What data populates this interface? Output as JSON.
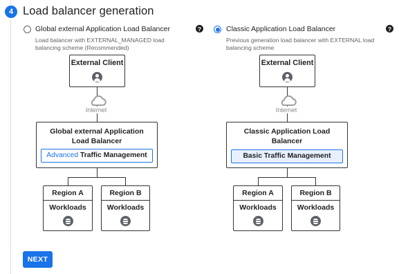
{
  "step": {
    "number": "4",
    "title": "Load balancer generation"
  },
  "options": [
    {
      "label": "Global external Application Load Balancer",
      "selected": false,
      "description_line1": "Load balancer with EXTERNAL_MANAGED load",
      "description_line2": "balancing scheme (Recommended)",
      "help": "?",
      "diagram": {
        "client": "External Client",
        "internet": "Internet",
        "lb_line1": "Global external Application",
        "lb_line2": "Load Balancer",
        "traffic_prefix": "Advanced",
        "traffic_suffix": "Traffic Management",
        "region_a": "Region A",
        "region_b": "Region B",
        "workloads": "Workloads"
      }
    },
    {
      "label": "Classic Application Load Balancer",
      "selected": true,
      "description_line1": "Previous generation load balancer with EXTERNAL load",
      "description_line2": "balancing scheme",
      "help": "?",
      "diagram": {
        "client": "External Client",
        "internet": "Internet",
        "lb_line1": "Classic Application Load",
        "lb_line2": "Balancer",
        "traffic": "Basic Traffic Management",
        "region_a": "Region A",
        "region_b": "Region B",
        "workloads": "Workloads"
      }
    }
  ],
  "next_button": "NEXT",
  "colors": {
    "accent": "#1a73e8",
    "text": "#202124",
    "muted": "#5f6368"
  }
}
